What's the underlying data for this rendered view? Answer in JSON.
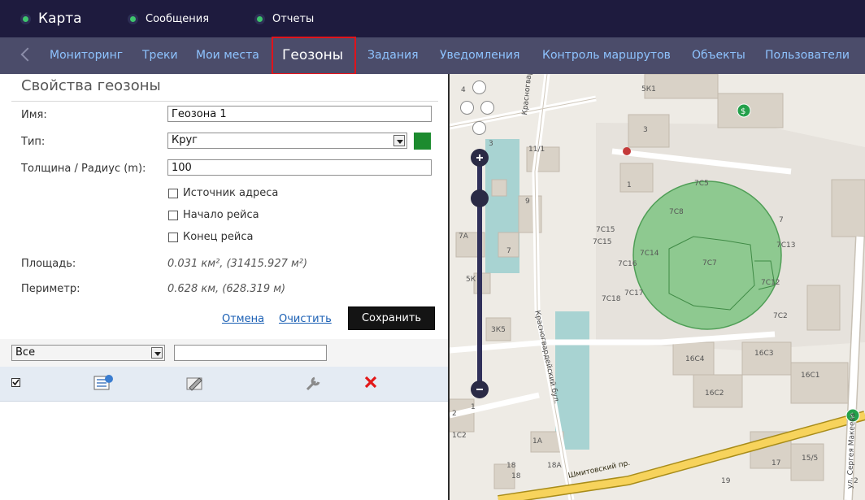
{
  "topbar": {
    "items": [
      "Карта",
      "Сообщения",
      "Отчеты"
    ]
  },
  "nav": {
    "tabs": [
      "Мониторинг",
      "Треки",
      "Мои места",
      "Геозоны",
      "Задания",
      "Уведомления",
      "Контроль маршрутов",
      "Объекты",
      "Пользователи"
    ],
    "active": "Геозоны"
  },
  "panel": {
    "title": "Свойства геозоны",
    "name_label": "Имя:",
    "name_value": "Геозона 1",
    "type_label": "Тип:",
    "type_value": "Круг",
    "radius_label": "Толщина / Радиус (m):",
    "radius_value": "100",
    "checkbox_address": "Источник адреса",
    "checkbox_start": "Начало рейса",
    "checkbox_end": "Конец рейса",
    "area_label": "Площадь:",
    "area_value": "0.031 км², (31415.927 м²)",
    "perimeter_label": "Периметр:",
    "perimeter_value": "0.628 км, (628.319 м)",
    "cancel_label": "Отмена",
    "clear_label": "Очистить",
    "save_label": "Сохранить",
    "zone_color": "#1c8b2e"
  },
  "filter": {
    "select_value": "Все"
  },
  "list_icons": [
    "checkbox-checked-icon",
    "geofence-properties-icon",
    "geofence-edit-icon",
    "wrench-icon",
    "delete-x-icon"
  ],
  "map": {
    "labels": [
      "5К1",
      "3",
      "11/1",
      "1",
      "9",
      "7С5",
      "7С8",
      "7",
      "7С15",
      "7С15",
      "7С14",
      "7С16",
      "7С7",
      "7С13",
      "7С12",
      "7С17",
      "7С18",
      "7С2",
      "7А",
      "7",
      "5К",
      "3К5",
      "16С4",
      "16С3",
      "16С1",
      "16С2",
      "1",
      "2",
      "1С2",
      "1А",
      "18",
      "18",
      "18А",
      "17",
      "15/5",
      "19",
      "2",
      "4",
      "3"
    ],
    "streets": [
      "Красногвардейский бул.",
      "Красногвардейский бул.",
      "Шмитовский пр.",
      "ул. Сергея Макеева"
    ],
    "geofence_color": "#6cbf73"
  }
}
